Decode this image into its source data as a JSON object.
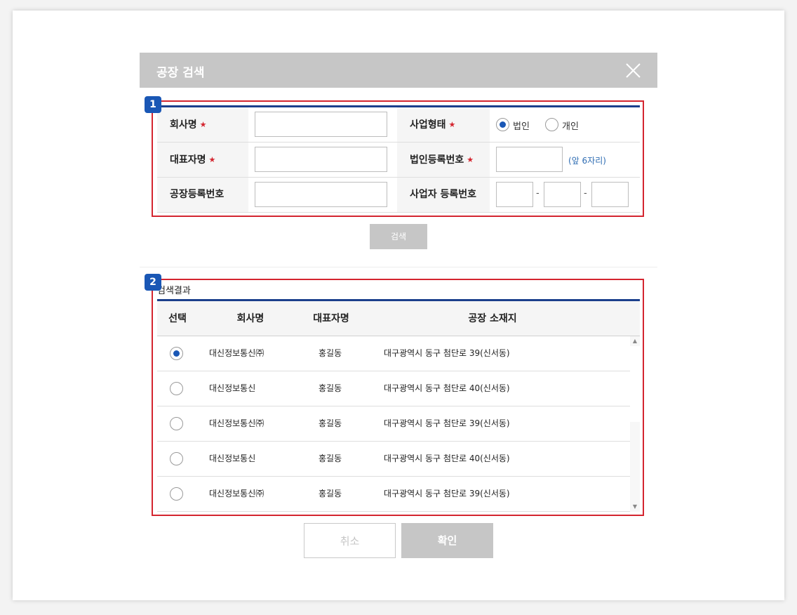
{
  "dialog": {
    "title": "공장 검색"
  },
  "markers": {
    "m1": "1",
    "m2": "2"
  },
  "form": {
    "company_label": "회사명",
    "biz_type_label": "사업형태",
    "biz_type_options": [
      "법인",
      "개인"
    ],
    "biz_type_selected": "법인",
    "ceo_label": "대표자명",
    "corp_reg_label": "법인등록번호",
    "corp_reg_hint": "(앞 6자리)",
    "factory_reg_label": "공장등록번호",
    "biz_reg_label": "사업자 등록번호",
    "dash": "-",
    "required_mark": "★"
  },
  "search_button": "검색",
  "results": {
    "title": "검색결과",
    "columns": [
      "선택",
      "회사명",
      "대표자명",
      "공장 소재지"
    ],
    "rows": [
      {
        "selected": true,
        "company": "대신정보통신㈜",
        "ceo": "홍길동",
        "address": "대구광역시 동구 첨단로 39(신서동)"
      },
      {
        "selected": false,
        "company": "대신정보통신",
        "ceo": "홍길동",
        "address": "대구광역시 동구 첨단로 40(신서동)"
      },
      {
        "selected": false,
        "company": "대신정보통신㈜",
        "ceo": "홍길동",
        "address": "대구광역시 동구 첨단로 39(신서동)"
      },
      {
        "selected": false,
        "company": "대신정보통신",
        "ceo": "홍길동",
        "address": "대구광역시 동구 첨단로 40(신서동)"
      },
      {
        "selected": false,
        "company": "대신정보통신㈜",
        "ceo": "홍길동",
        "address": "대구광역시 동구 첨단로 39(신서동)"
      }
    ]
  },
  "buttons": {
    "cancel": "취소",
    "confirm": "확인"
  },
  "colors": {
    "header_bg": "#c6c6c6",
    "accent_blue": "#1a57b5",
    "table_rule": "#1b3f8c",
    "highlight_red": "#d4252f",
    "hint_blue": "#2f6db3"
  }
}
